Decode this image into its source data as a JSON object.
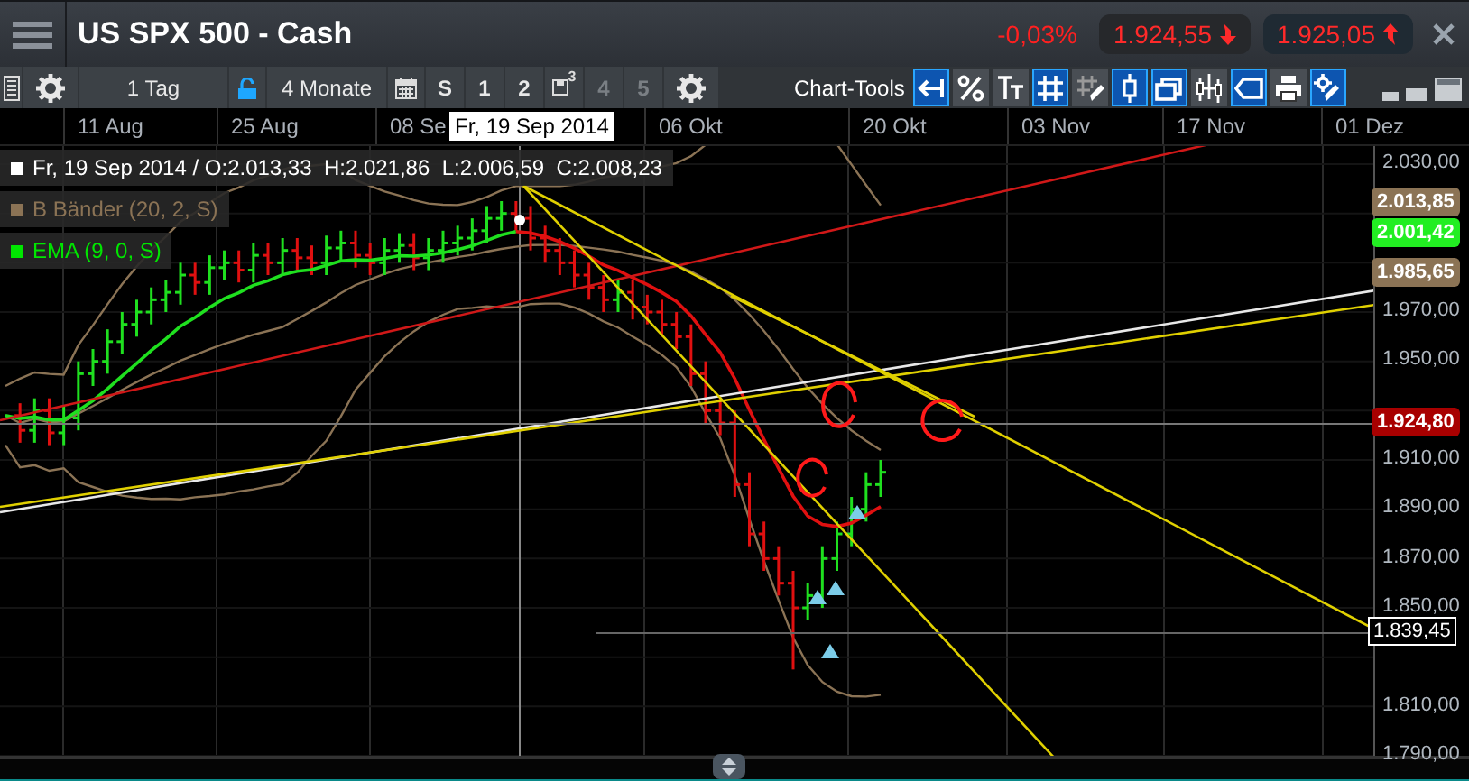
{
  "header": {
    "title": "US SPX 500 - Cash",
    "change": "-0,03%",
    "bid": "1.924,55",
    "ask": "1.925,05"
  },
  "toolbar": {
    "interval": "1 Tag",
    "range": "4 Monate",
    "slots": [
      {
        "label": "S",
        "kind": "text",
        "disabled": false
      },
      {
        "label": "1",
        "kind": "text",
        "disabled": false
      },
      {
        "label": "2",
        "kind": "text",
        "disabled": false
      },
      {
        "label": "3",
        "kind": "save",
        "disabled": false
      },
      {
        "label": "4",
        "kind": "text",
        "disabled": true
      },
      {
        "label": "5",
        "kind": "text",
        "disabled": true
      }
    ],
    "tools_label": "Chart-Tools",
    "tools": [
      {
        "kind": "back",
        "on": true
      },
      {
        "kind": "percent",
        "on": false
      },
      {
        "kind": "text",
        "on": false
      },
      {
        "kind": "grid",
        "on": true
      },
      {
        "kind": "draw",
        "on": false
      },
      {
        "kind": "candle",
        "on": true
      },
      {
        "kind": "windows",
        "on": true
      },
      {
        "kind": "bars",
        "on": false
      },
      {
        "kind": "tag",
        "on": true
      },
      {
        "kind": "print",
        "on": false
      },
      {
        "kind": "settings",
        "on": true
      }
    ]
  },
  "x_axis": {
    "labels": [
      "11 Aug",
      "25 Aug",
      "08 Se",
      "06 Okt",
      "20 Okt",
      "03 Nov",
      "17 Nov",
      "01 Dez"
    ],
    "cursor_label": "Fr, 19 Sep 2014"
  },
  "legend": [
    {
      "text": "Fr, 19 Sep 2014 / O:2.013,33  H:2.021,86  L:2.006,59  C:2.008,23",
      "color": "#ffffff"
    },
    {
      "text": "B Bänder (20, 2, S)",
      "color": "#8b7355"
    },
    {
      "text": "EMA (9, 0, S)",
      "color": "#00e600"
    }
  ],
  "y_axis": {
    "ticks": [
      "2.030,00",
      "1.970,00",
      "1.950,00",
      "1.910,00",
      "1.890,00",
      "1.870,00",
      "1.850,00",
      "1.810,00",
      "1.790,00"
    ],
    "tags": [
      {
        "text": "2.013,85",
        "color": "#8b7355"
      },
      {
        "text": "2.001,42",
        "color": "#22ee22"
      },
      {
        "text": "1.985,65",
        "color": "#8b7355"
      },
      {
        "text": "1.924,80",
        "color": "#a80000"
      },
      {
        "text": "1.839,45",
        "color": "#000000"
      }
    ]
  }
}
